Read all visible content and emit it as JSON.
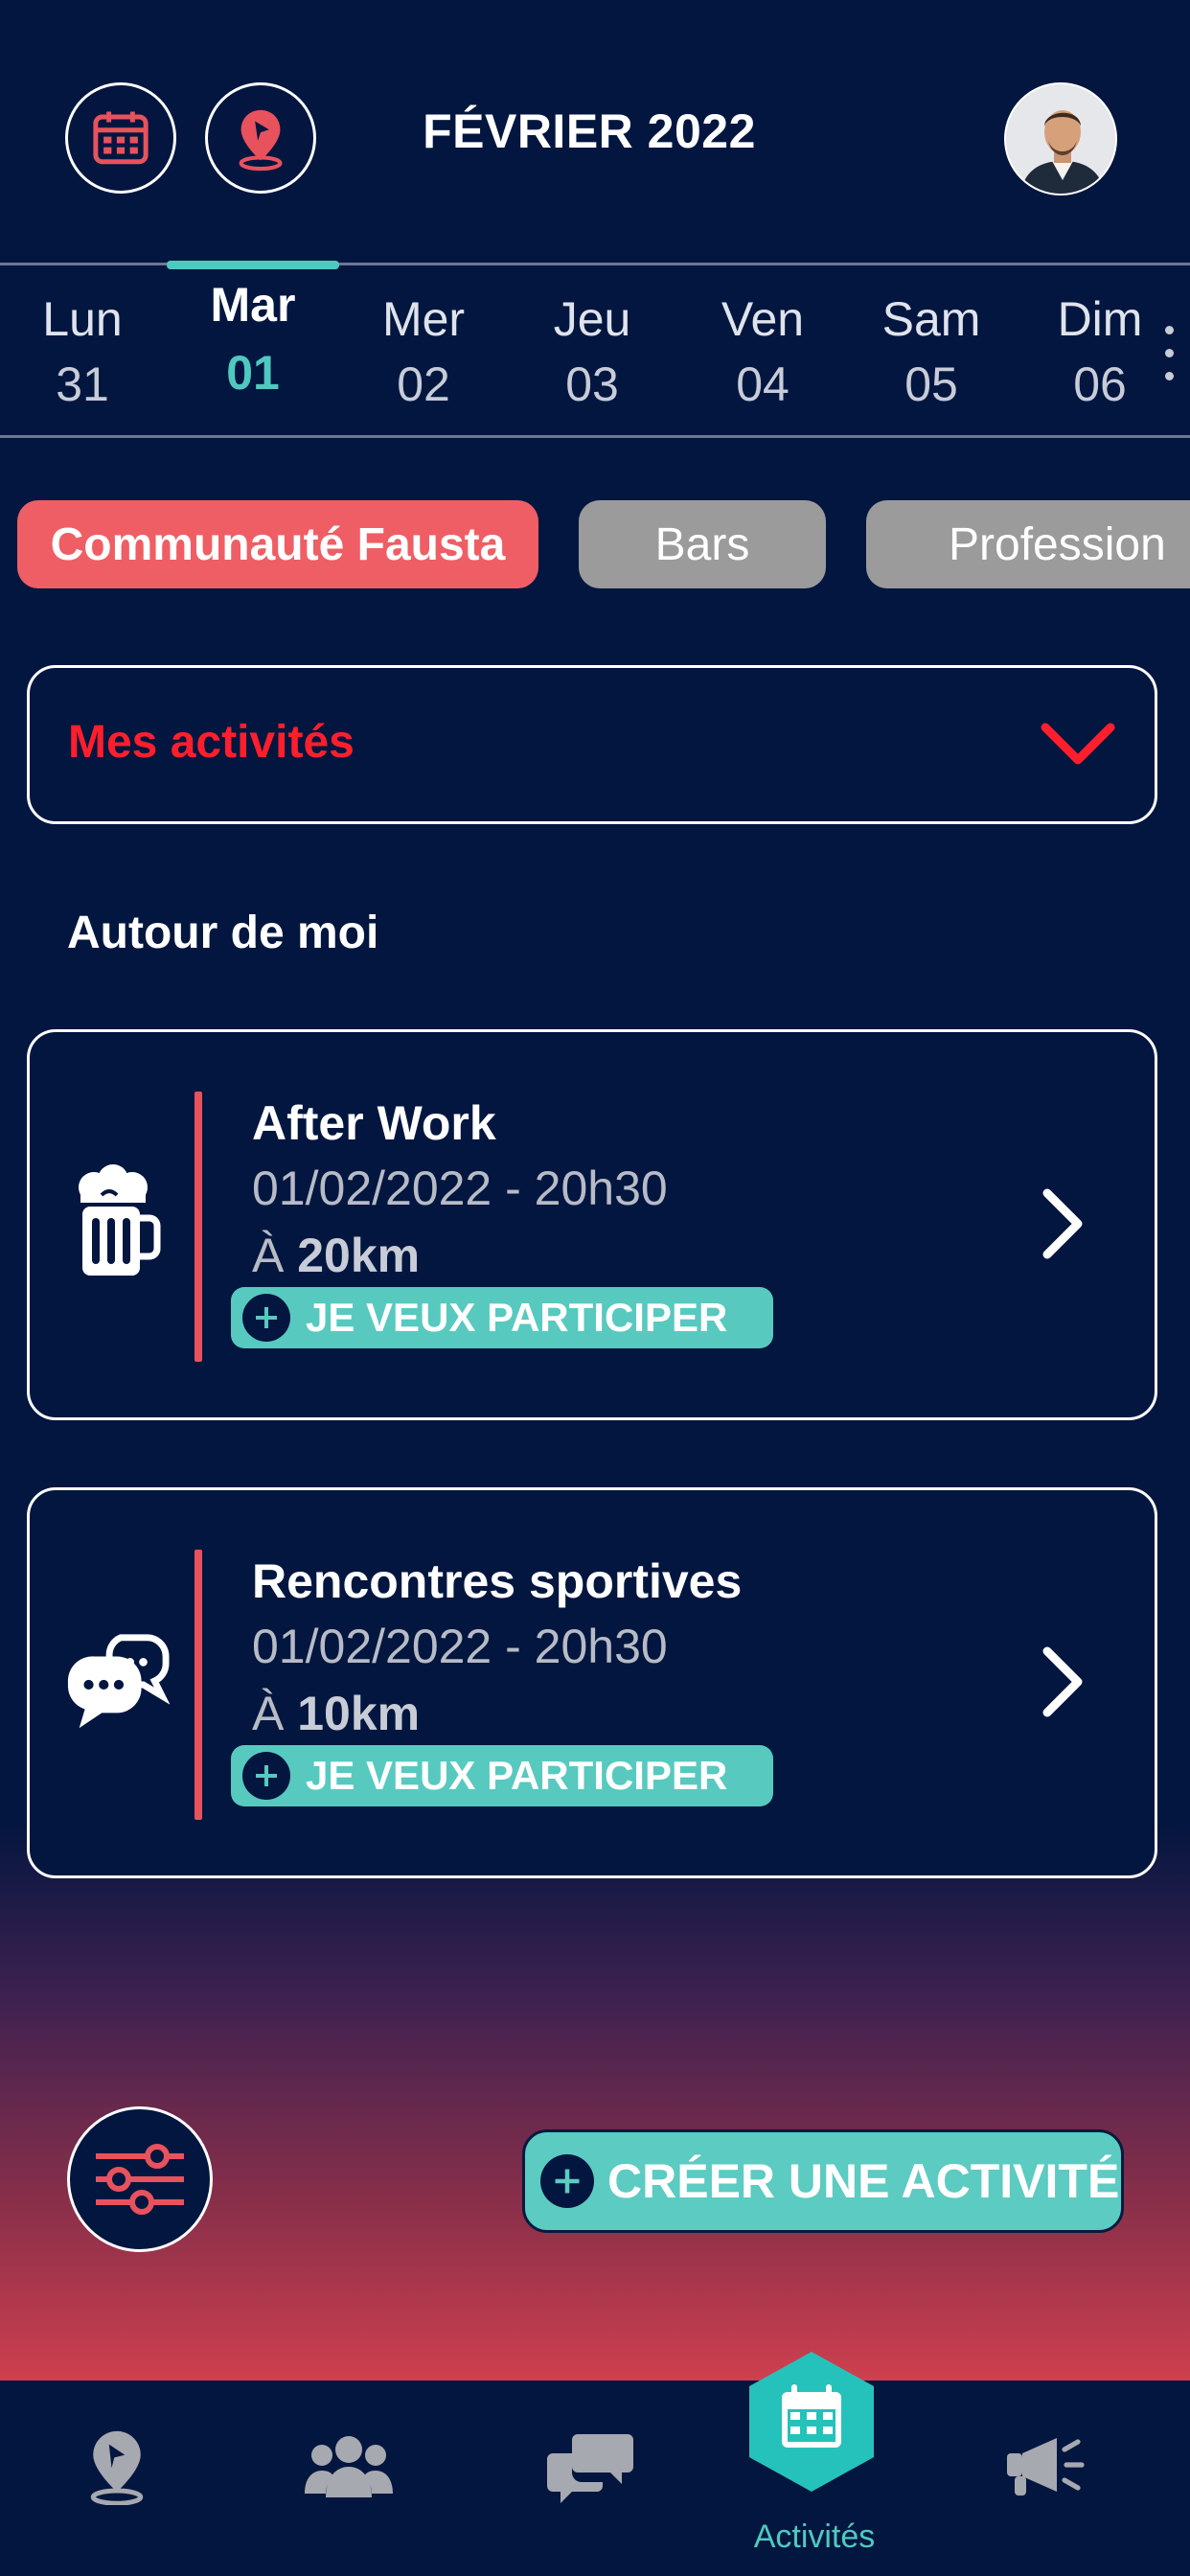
{
  "header": {
    "title": "FÉVRIER 2022",
    "calendar_icon": "calendar-icon",
    "location_icon": "map-pin-icon",
    "avatar": "user-avatar"
  },
  "days": [
    {
      "name": "Lun",
      "num": "31",
      "selected": false
    },
    {
      "name": "Mar",
      "num": "01",
      "selected": true
    },
    {
      "name": "Mer",
      "num": "02",
      "selected": false
    },
    {
      "name": "Jeu",
      "num": "03",
      "selected": false
    },
    {
      "name": "Ven",
      "num": "04",
      "selected": false
    },
    {
      "name": "Sam",
      "num": "05",
      "selected": false
    },
    {
      "name": "Dim",
      "num": "06",
      "selected": false
    }
  ],
  "categories": [
    "Communauté Fausta",
    "Bars",
    "Profession"
  ],
  "dropdown": {
    "label": "Mes activités"
  },
  "section_title": "Autour de moi",
  "activities": [
    {
      "title": "After Work",
      "date": "01/02/2022 - 20h30",
      "dist_prefix": "À ",
      "distance": "20km",
      "cta": "JE VEUX PARTICIPER",
      "icon": "beer-mug-icon"
    },
    {
      "title": "Rencontres sportives",
      "date": "01/02/2022 - 20h30",
      "dist_prefix": "À ",
      "distance": "10km",
      "cta": "JE VEUX PARTICIPER",
      "icon": "chat-bubbles-icon"
    }
  ],
  "create_button": "CRÉER UNE ACTIVITÉ",
  "nav": {
    "active_label": "Activités",
    "items": [
      "map-pin-icon",
      "users-icon",
      "chat-icon",
      "calendar-icon",
      "megaphone-icon"
    ]
  },
  "colors": {
    "background": "#03163f",
    "accent_teal": "#4fc9c0",
    "accent_red": "#ef5e64",
    "dropdown_text": "#ff1f2c"
  }
}
